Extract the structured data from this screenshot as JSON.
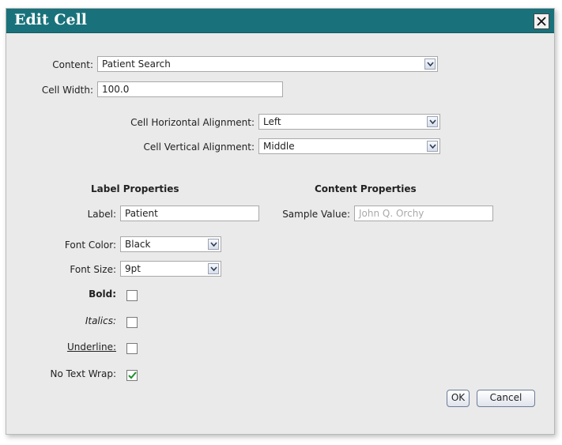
{
  "dialog": {
    "title": "Edit Cell",
    "close_label": "X"
  },
  "content": {
    "label": "Content:",
    "value": "Patient Search"
  },
  "cell_width": {
    "label": "Cell Width:",
    "value": "100.0"
  },
  "horizontal_alignment": {
    "label": "Cell Horizontal Alignment:",
    "value": "Left"
  },
  "vertical_alignment": {
    "label": "Cell Vertical Alignment:",
    "value": "Middle"
  },
  "label_properties": {
    "heading": "Label Properties",
    "label_label": "Label:",
    "label_value": "Patient",
    "font_color_label": "Font Color:",
    "font_color_value": "Black",
    "font_size_label": "Font Size:",
    "font_size_value": "9pt",
    "bold_label": "Bold:",
    "bold_checked": false,
    "italics_label": "Italics:",
    "italics_checked": false,
    "underline_label": "Underline:",
    "underline_checked": false,
    "no_wrap_label": "No Text Wrap:",
    "no_wrap_checked": true
  },
  "content_properties": {
    "heading": "Content Properties",
    "sample_value_label": "Sample Value:",
    "sample_value_placeholder": "John Q. Orchy"
  },
  "buttons": {
    "ok": "OK",
    "cancel": "Cancel"
  },
  "colors": {
    "titlebar": "#19727b",
    "dialog_bg": "#eaeaea",
    "check_mark": "#1f8f2a"
  },
  "icons": {
    "close": "close-icon",
    "dropdown": "chevron-down-icon",
    "check": "check-icon"
  }
}
